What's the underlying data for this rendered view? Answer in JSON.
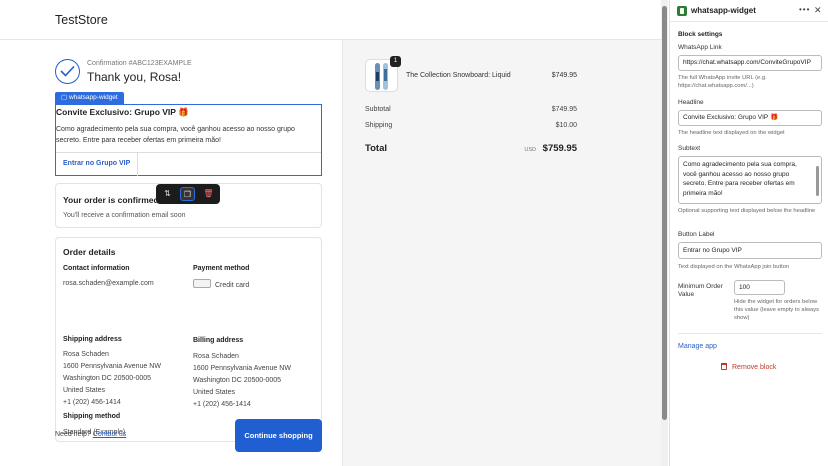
{
  "header": {
    "store_name": "TestStore"
  },
  "confirmation": {
    "number": "Confirmation #ABC123EXAMPLE",
    "thank_you": "Thank you, Rosa!"
  },
  "widget": {
    "tag": "whatsapp-widget",
    "headline": "Convite Exclusivo: Grupo VIP 🎁",
    "subtext": "Como agradecimento pela sua compra, você ganhou acesso ao nosso grupo secreto. Entre para receber ofertas em primeira mão!",
    "button": "Entrar no Grupo VIP"
  },
  "toolbar": {
    "move_icon": "⇅",
    "duplicate_icon": "❐",
    "delete_icon": "🗑"
  },
  "order_confirmed": {
    "title": "Your order is confirmed",
    "text": "You'll receive a confirmation email soon"
  },
  "order_details": {
    "title": "Order details",
    "contact_label": "Contact information",
    "contact_email": "rosa.schaden@example.com",
    "payment_label": "Payment method",
    "payment_value": "Credit card",
    "shipping_address_label": "Shipping address",
    "shipping_address": [
      "Rosa Schaden",
      "1600 Pennsylvania Avenue NW",
      "Washington DC 20500-0005",
      "United States",
      "+1 (202) 456-1414"
    ],
    "billing_address_label": "Billing address",
    "billing_address": [
      "Rosa Schaden",
      "1600 Pennsylvania Avenue NW",
      "Washington DC 20500-0005",
      "United States",
      "+1 (202) 456-1414"
    ],
    "shipping_method_label": "Shipping method",
    "shipping_method": "Standard (Example)"
  },
  "footer": {
    "help_text": "Need help?",
    "contact_link": "Contact us",
    "continue_button": "Continue shopping"
  },
  "summary": {
    "product_name": "The Collection Snowboard: Liquid",
    "product_price": "$749.95",
    "quantity": "1",
    "subtotal_label": "Subtotal",
    "subtotal_value": "$749.95",
    "shipping_label": "Shipping",
    "shipping_value": "$10.00",
    "total_label": "Total",
    "currency": "USD",
    "total_value": "$759.95"
  },
  "panel": {
    "title": "whatsapp-widget",
    "more_icon": "•••",
    "close_icon": "✕",
    "section_title": "Block settings",
    "link_label": "WhatsApp Link",
    "link_value": "https://chat.whatsapp.com/ConviteGrupoVIP",
    "link_help": "The full WhatsApp invite URL (e.g. https://chat.whatsapp.com/...)",
    "headline_label": "Headline",
    "headline_value": "Convite Exclusivo: Grupo VIP 🎁",
    "headline_help": "The headline text displayed on the widget",
    "subtext_label": "Subtext",
    "subtext_value": "Como agradecimento pela sua compra, você ganhou acesso ao nosso grupo secreto. Entre para receber ofertas em primeira mão!",
    "subtext_help": "Optional supporting text displayed below the headline",
    "button_label": "Button Label",
    "button_value": "Entrar no Grupo VIP",
    "button_help": "Text displayed on the WhatsApp join button",
    "min_label": "Minimum Order Value",
    "min_value": "100",
    "min_help": "Hide the widget for orders below this value (leave empty to always show)",
    "manage_app": "Manage app",
    "remove_block": "Remove block"
  },
  "colors": {
    "accent": "#2d6cdf",
    "primary_button": "#1f5fd1",
    "danger": "#c0392b",
    "app_icon": "#2e7d32"
  }
}
